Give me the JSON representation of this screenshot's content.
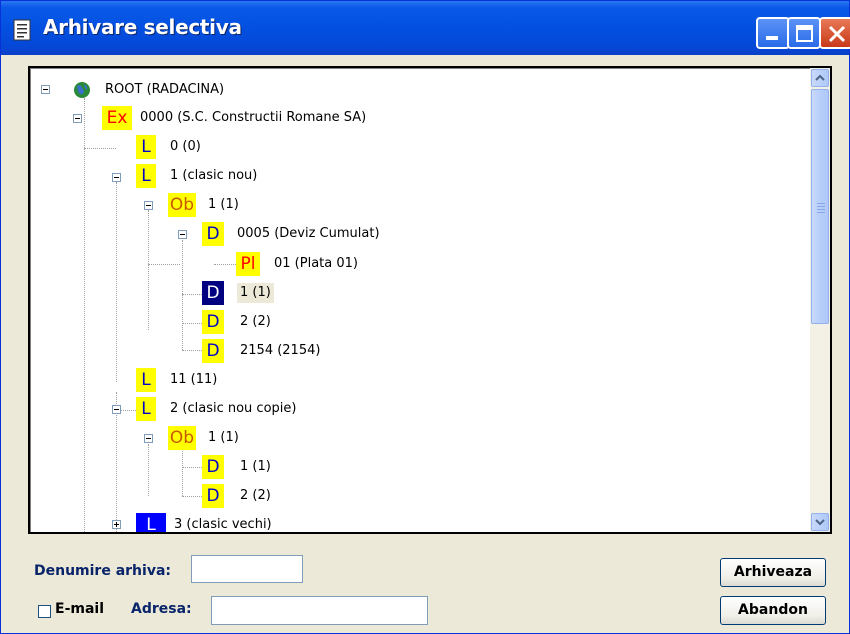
{
  "window": {
    "title": "Arhivare selectiva"
  },
  "tree": {
    "nodes": [
      {
        "icon_text": "",
        "icon_name": "globe-icon",
        "label": "ROOT (RADACINA)"
      },
      {
        "icon_text": "Ex",
        "icon_name": "ex-icon",
        "label": "0000 (S.C. Constructii Romane SA)"
      },
      {
        "icon_text": "L",
        "icon_name": "l-icon",
        "label": "0 (0)"
      },
      {
        "icon_text": "L",
        "icon_name": "l-icon",
        "label": "1 (clasic nou)"
      },
      {
        "icon_text": "Ob",
        "icon_name": "ob-icon",
        "label": "1 (1)"
      },
      {
        "icon_text": "D",
        "icon_name": "d-icon",
        "label": "0005 (Deviz Cumulat)"
      },
      {
        "icon_text": "Pl",
        "icon_name": "pl-icon",
        "label": "01 (Plata 01)"
      },
      {
        "icon_text": "D",
        "icon_name": "d-icon",
        "label": "1 (1)",
        "selected": true
      },
      {
        "icon_text": "D",
        "icon_name": "d-icon",
        "label": "2 (2)"
      },
      {
        "icon_text": "D",
        "icon_name": "d-icon",
        "label": "2154 (2154)"
      },
      {
        "icon_text": "L",
        "icon_name": "l-icon",
        "label": "11 (11)"
      },
      {
        "icon_text": "L",
        "icon_name": "l-icon",
        "label": "2 (clasic nou copie)"
      },
      {
        "icon_text": "Ob",
        "icon_name": "ob-icon",
        "label": "1 (1)"
      },
      {
        "icon_text": "D",
        "icon_name": "d-icon",
        "label": "1 (1)"
      },
      {
        "icon_text": "D",
        "icon_name": "d-icon",
        "label": "2 (2)"
      },
      {
        "icon_text": "L",
        "icon_name": "l-icon",
        "label": "3 (clasic vechi)"
      }
    ]
  },
  "form": {
    "archive_name_label": "Denumire arhiva:",
    "archive_name_value": "",
    "email_label": "E-mail",
    "email_checked": false,
    "address_label": "Adresa:",
    "address_value": ""
  },
  "buttons": {
    "archive": "Arhiveaza",
    "cancel": "Abandon"
  },
  "colors": {
    "icon_yellow": "#ffff00",
    "icon_red_text": "#ff0000",
    "selected_icon_bg": "#000080",
    "label_blue": "#0a246a"
  }
}
